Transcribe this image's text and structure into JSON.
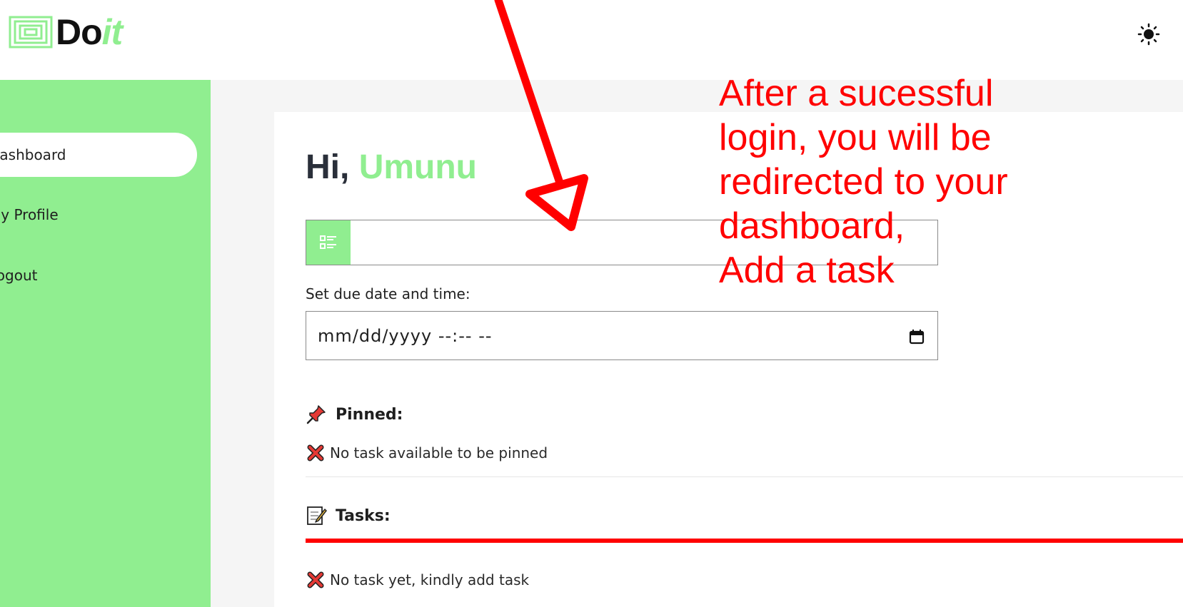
{
  "app": {
    "logo_do": "Do",
    "logo_it": "it",
    "brand_color": "#90ee90",
    "theme_toggle_icon": "sun-icon"
  },
  "sidebar": {
    "items": [
      {
        "label": "Dashboard",
        "active": true
      },
      {
        "label": "My Profile",
        "active": false
      },
      {
        "label": "Logout",
        "active": false
      }
    ]
  },
  "main": {
    "greeting_prefix": "Hi,",
    "user_name": "Umunu",
    "task_input": {
      "value": "",
      "placeholder": "",
      "icon": "list-icon"
    },
    "due_label": "Set due date and time:",
    "due_value": "mm/dd/yyyy --:-- --",
    "pinned": {
      "title": "Pinned:",
      "icon": "pushpin-icon",
      "empty_text": "No task available to be pinned"
    },
    "tasks": {
      "title": "Tasks:",
      "icon": "memo-icon",
      "empty_text": "No task yet, kindly add task"
    }
  },
  "annotation": {
    "text": "After a sucessful\nlogin, you will be\nredirected to your\ndashboard,\nAdd a task",
    "color": "#ff0000"
  }
}
